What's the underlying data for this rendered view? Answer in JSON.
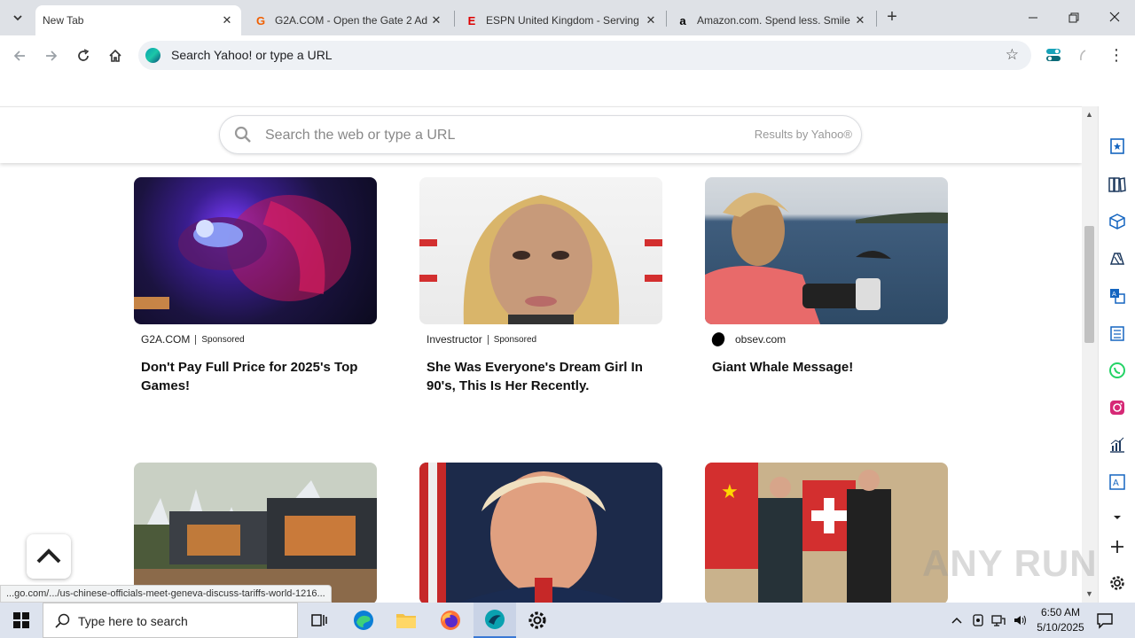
{
  "tabs": [
    {
      "title": "New Tab",
      "active": true,
      "favicon": "none"
    },
    {
      "title": "G2A.COM - Open the Gate 2 Ad",
      "active": false,
      "favicon": "g2a-icon"
    },
    {
      "title": "ESPN United Kingdom - Serving",
      "active": false,
      "favicon": "espn-icon"
    },
    {
      "title": "Amazon.com. Spend less. Smile",
      "active": false,
      "favicon": "amazon-icon"
    }
  ],
  "toolbar": {
    "omnibox_text": "Search Yahoo! or type a URL"
  },
  "page": {
    "search_placeholder": "Search the web or type a URL",
    "results_by": "Results by Yahoo®"
  },
  "cards": [
    {
      "source": "G2A.COM",
      "sponsored": "Sponsored",
      "headline": "Don't Pay Full Price for 2025's Top Games!"
    },
    {
      "source": "Investructor",
      "sponsored": "Sponsored",
      "headline": "She Was Everyone's Dream Girl In 90's, This Is Her Recently."
    },
    {
      "source": "obsev.com",
      "sponsored": "",
      "headline": "Giant Whale Message!"
    }
  ],
  "status_url": "...go.com/.../us-chinese-officials-meet-geneva-discuss-tariffs-world-1216...",
  "watermark": "ANY RUN",
  "taskbar": {
    "search_placeholder": "Type here to search",
    "time": "6:50 AM",
    "date": "5/10/2025"
  },
  "colors": {
    "tabstrip": "#dee1e6",
    "omnibox": "#eef1f5",
    "taskbar": "#dde3ee",
    "accent": "#3a78d4"
  }
}
